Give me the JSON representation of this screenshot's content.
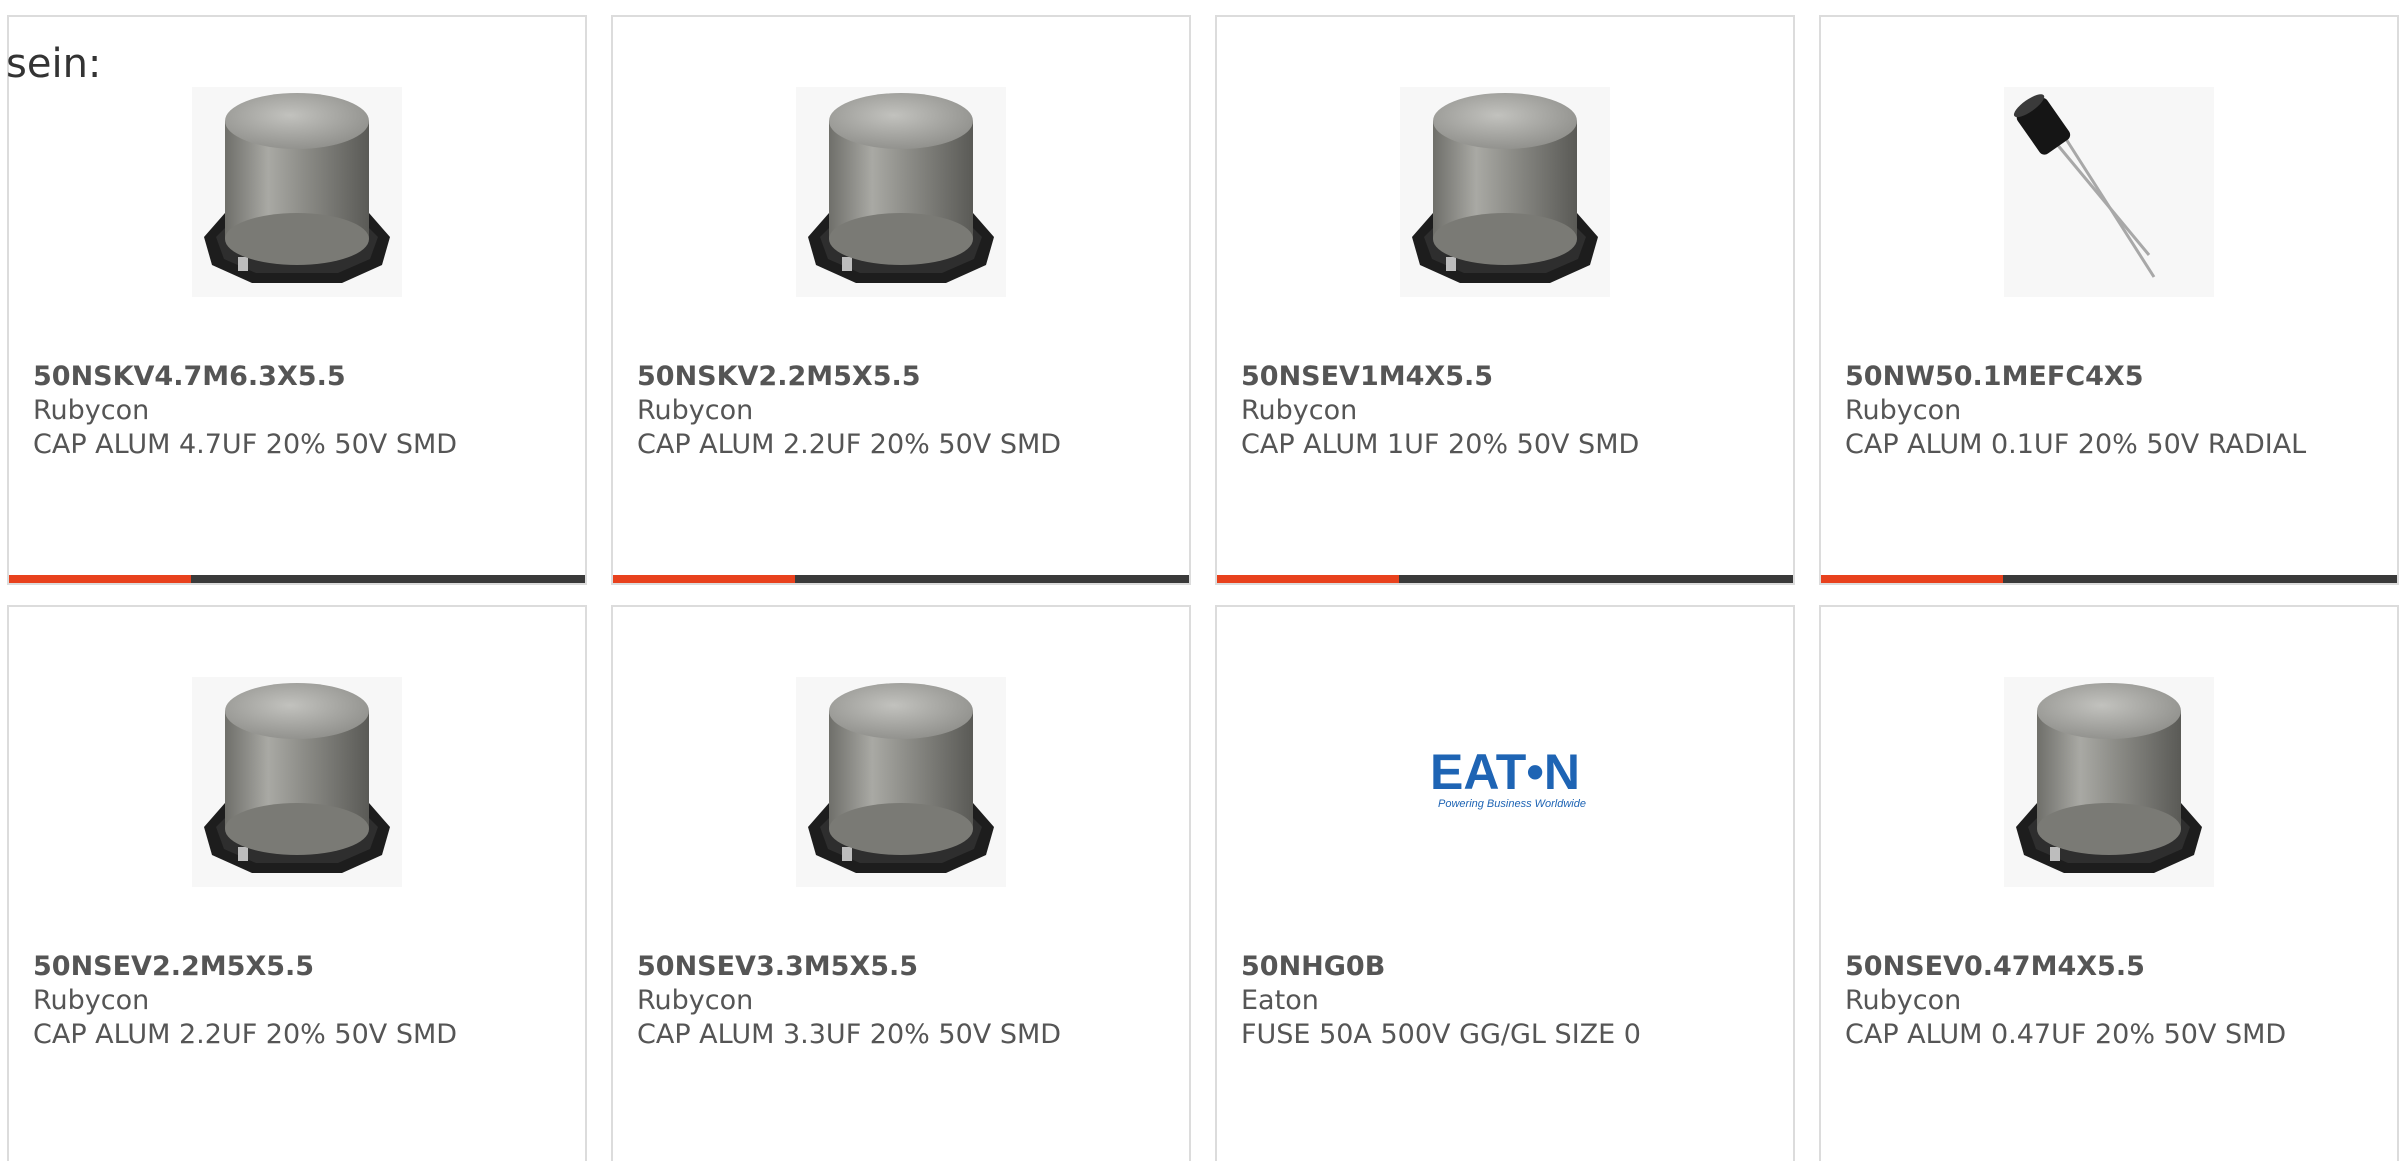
{
  "intro_text": "sein:",
  "colors": {
    "accent": "#e8411d",
    "bar": "#3a3a3a",
    "card_border": "#dcdcdc",
    "text": "#555555",
    "eaton_blue": "#1e64b4"
  },
  "products": [
    {
      "part": "50NSKV4.7M6.3X5.5",
      "maker": "Rubycon",
      "desc": "CAP ALUM 4.7UF 20% 50V SMD",
      "image": "smd-capacitor-image"
    },
    {
      "part": "50NSKV2.2M5X5.5",
      "maker": "Rubycon",
      "desc": "CAP ALUM 2.2UF 20% 50V SMD",
      "image": "smd-capacitor-image"
    },
    {
      "part": "50NSEV1M4X5.5",
      "maker": "Rubycon",
      "desc": "CAP ALUM 1UF 20% 50V SMD",
      "image": "smd-capacitor-image"
    },
    {
      "part": "50NW50.1MEFC4X5",
      "maker": "Rubycon",
      "desc": "CAP ALUM 0.1UF 20% 50V RADIAL",
      "image": "radial-capacitor-image"
    },
    {
      "part": "50NSEV2.2M5X5.5",
      "maker": "Rubycon",
      "desc": "CAP ALUM 2.2UF 20% 50V SMD",
      "image": "smd-capacitor-image"
    },
    {
      "part": "50NSEV3.3M5X5.5",
      "maker": "Rubycon",
      "desc": "CAP ALUM 3.3UF 20% 50V SMD",
      "image": "smd-capacitor-image"
    },
    {
      "part": "50NHG0B",
      "maker": "Eaton",
      "desc": "FUSE 50A 500V GG/GL SIZE 0",
      "image": "eaton-logo",
      "logo_text": "EAT•N",
      "logo_tagline": "Powering Business Worldwide"
    },
    {
      "part": "50NSEV0.47M4X5.5",
      "maker": "Rubycon",
      "desc": "CAP ALUM 0.47UF 20% 50V SMD",
      "image": "smd-capacitor-image"
    }
  ]
}
